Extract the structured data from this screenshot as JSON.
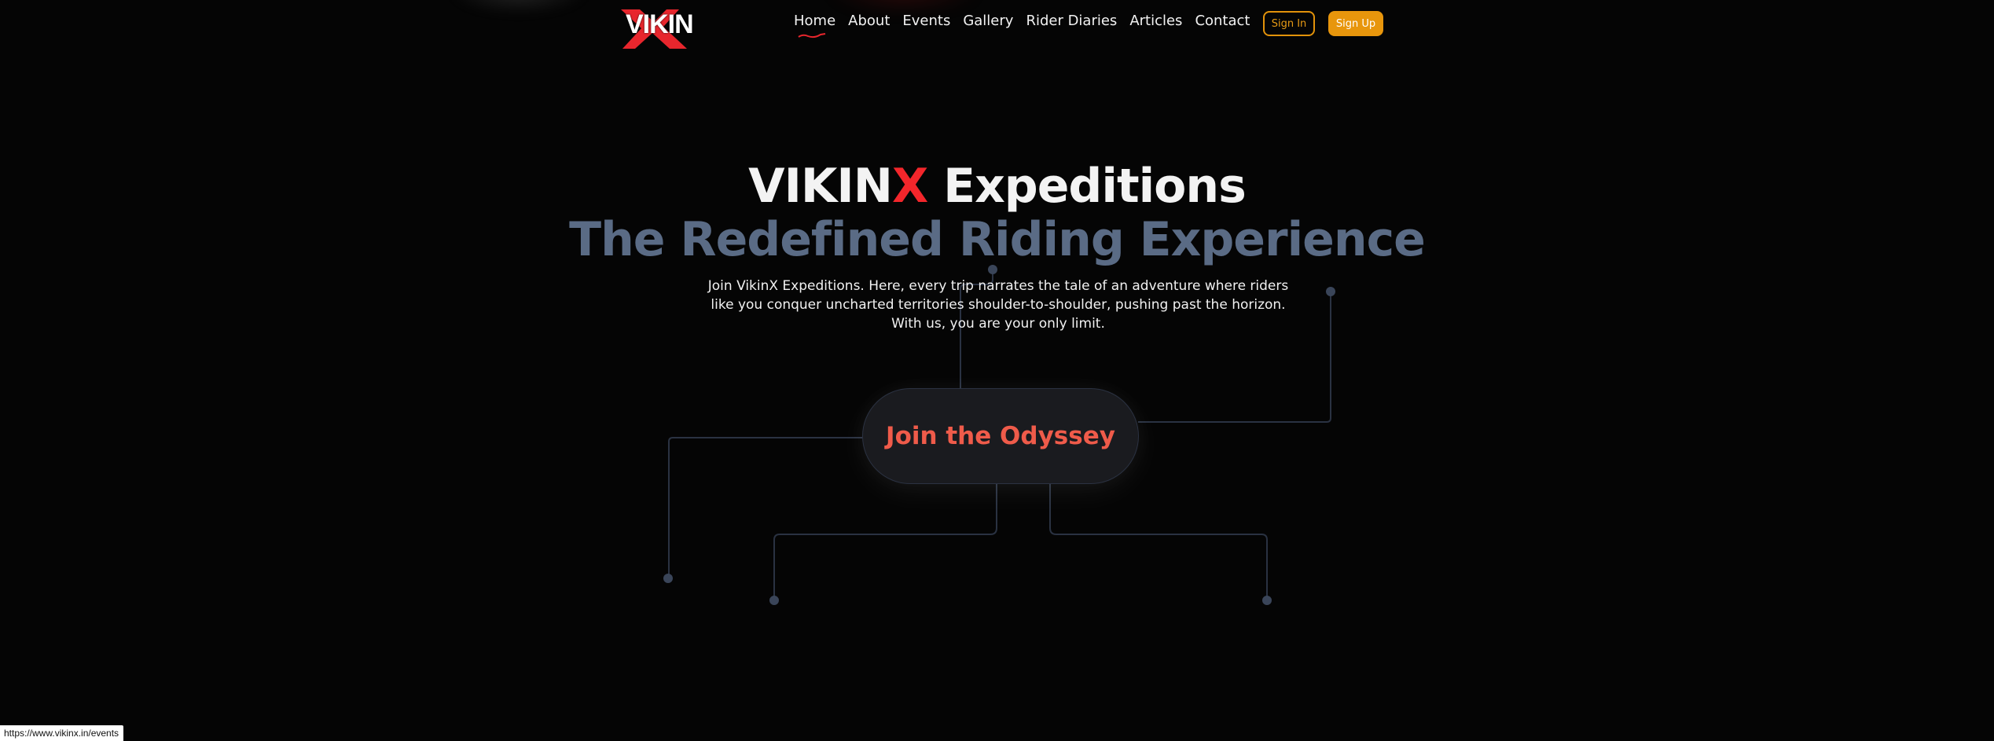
{
  "logo": {
    "text": "VIKIN"
  },
  "nav": {
    "items": [
      {
        "label": "Home",
        "active": true
      },
      {
        "label": "About"
      },
      {
        "label": "Events"
      },
      {
        "label": "Gallery"
      },
      {
        "label": "Rider Diaries"
      },
      {
        "label": "Articles"
      },
      {
        "label": "Contact"
      }
    ],
    "signin_label": "Sign In",
    "signup_label": "Sign Up"
  },
  "hero": {
    "title_part1": "VIKIN",
    "title_x": "X",
    "title_part2": " Expeditions",
    "subtitle": "The Redefined Riding Experience",
    "description_lines": [
      "Join VikinX Expeditions. Here, every trip narrates the tale of an adventure where riders",
      "like you conquer uncharted territories shoulder-to-shoulder, pushing past the horizon.",
      "With us, you are your only limit."
    ],
    "cta_label": "Join the Odyssey"
  },
  "status_bar": {
    "url": "https://www.vikinx.in/events"
  },
  "colors": {
    "background": "#050505",
    "accent_red": "#f3262b",
    "cta_text": "#ef5b4a",
    "signup_bg": "#e8960c",
    "subtitle": "#5a6b85",
    "circuit": "#2f3749",
    "circuit_node": "#3a4559"
  }
}
